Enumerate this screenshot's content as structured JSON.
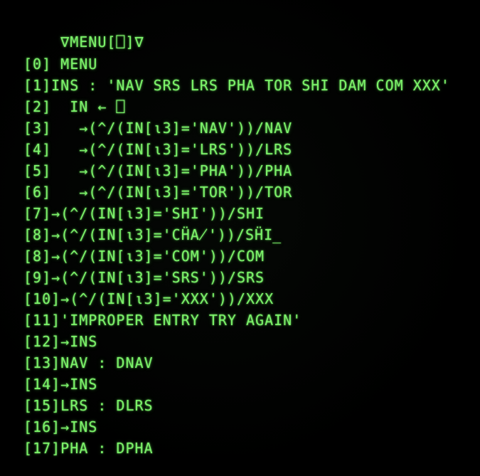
{
  "terminal": {
    "title_line": "    ∇MENU[⎕]∇",
    "lines": [
      "[0] MENU",
      "[1]INS : 'NAV SRS LRS PHA TOR SHI DAM COM XXX'",
      "[2]  IN ← ⎕",
      "[3]   →(^/(IN[⍳3]='NAV'))/NAV",
      "[4]   →(^/(IN[⍳3]='LRS'))/LRS",
      "[5]   →(^/(IN[⍳3]='PHA'))/PHA",
      "[6]   →(^/(IN[⍳3]='TOR'))/TOR",
      "[7]→(^/(IN[⍳3]='SHI'))/SHI",
      "[8]→(^/(IN[⍳3]='CḦA̸'))/SḦI̲",
      "[8]→(^/(IN[⍳3]='COM'))/COM",
      "[9]→(^/(IN[⍳3]='SRS'))/SRS",
      "[10]→(^/(IN[⍳3]='XXX'))/XXX",
      "[11]'IMPROPER ENTRY TRY AGAIN'",
      "[12]→INS",
      "[13]NAV : DNAV",
      "[14]→INS",
      "[15]LRS : DLRS",
      "[16]→INS",
      "[17]PHA : DPHA"
    ]
  },
  "colors": {
    "phosphor": "#7cf36a",
    "background": "#000000"
  }
}
